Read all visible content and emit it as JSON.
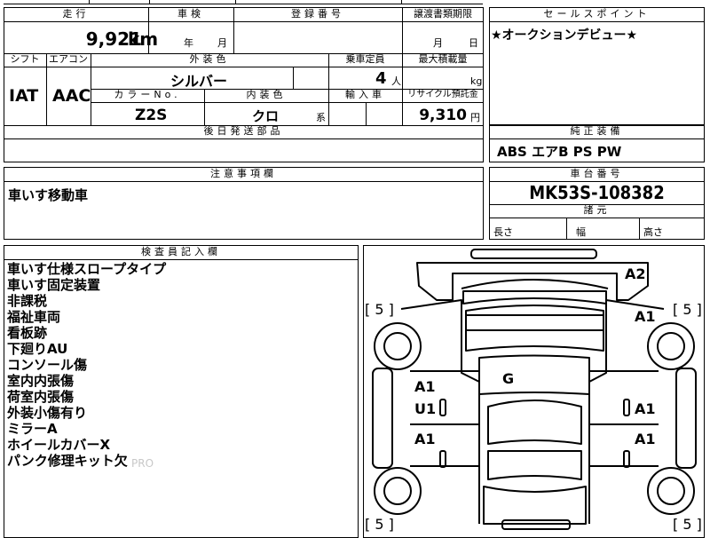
{
  "top_strip": {
    "fragment_a": "",
    "fragment_b": ""
  },
  "mileage": {
    "header": "走行",
    "value": "9,921",
    "unit": "km"
  },
  "shaken": {
    "header": "車検",
    "year_unit": "年",
    "month_unit": "月"
  },
  "registration": {
    "header": "登録番号",
    "value": ""
  },
  "transfer_deadline": {
    "header": "譲渡書類期限",
    "month_unit": "月",
    "day_unit": "日"
  },
  "sales_point": {
    "header": "セールスポイント",
    "text": "★オークションデビュー★"
  },
  "shift": {
    "header": "シフト",
    "value": "IAT"
  },
  "aircon": {
    "header": "エアコン",
    "value": "AAC"
  },
  "exterior_color": {
    "header": "外装色",
    "value": "シルバー"
  },
  "capacity": {
    "header": "乗車定員",
    "value": "4",
    "unit": "人"
  },
  "max_load": {
    "header": "最大積載量",
    "unit": "kg"
  },
  "color_no": {
    "header": "カラーNo.",
    "value": "Z2S"
  },
  "interior_color": {
    "header": "内装色",
    "value": "クロ",
    "suffix": "系"
  },
  "import_car": {
    "header": "輸入車"
  },
  "recycle": {
    "header": "リサイクル預託金",
    "value": "9,310",
    "unit": "円"
  },
  "later_parts": {
    "header": "後日発送部品"
  },
  "standard_equipment": {
    "header": "純正装備",
    "items": "ABS エアB PS PW"
  },
  "notes": {
    "header": "注意事項欄",
    "text": "車いす移動車"
  },
  "chassis": {
    "header": "車台番号",
    "value": "MK53S-108382"
  },
  "dimensions": {
    "header": "諸元",
    "length_label": "長さ",
    "width_label": "幅",
    "height_label": "高さ"
  },
  "inspector": {
    "header": "検査員記入欄",
    "lines": [
      "車いす仕様スロープタイプ",
      "車いす固定装置",
      "非課税",
      "福祉車両",
      "看板跡",
      "下廻りAU",
      "コンソール傷",
      "室内内張傷",
      "荷室内張傷",
      "外装小傷有り",
      "ミラーA",
      "ホイールカバーX",
      "パンク修理キット欠"
    ],
    "watermark": "PRO"
  },
  "diagram": {
    "marks": {
      "rear_top": "A2",
      "left_front_tire": "[ 5 ]",
      "right_front_tire": "[ 5 ]",
      "right_front_fender": "A1",
      "roof": "G",
      "left_front_door_a": "A1",
      "left_front_door_u": "U1",
      "right_front_door": "A1",
      "left_rear_door": "A1",
      "right_rear_door": "A1",
      "left_rear_tire": "[ 5 ]",
      "right_rear_tire": "[ 5 ]"
    }
  }
}
